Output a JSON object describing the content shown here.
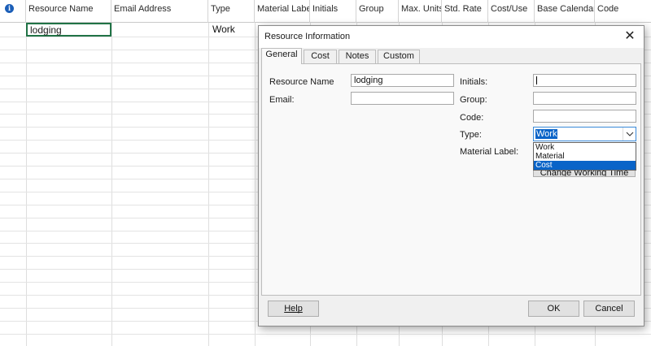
{
  "sheet": {
    "columns": [
      "Resource Name",
      "Email Address",
      "Type",
      "Material Label",
      "Initials",
      "Group",
      "Max. Units",
      "Std. Rate",
      "Cost/Use",
      "Base Calendar",
      "Code"
    ],
    "row1": {
      "resource_name": "lodging",
      "type": "Work"
    }
  },
  "dialog": {
    "title": "Resource Information",
    "tabs": [
      "General",
      "Cost",
      "Notes",
      "Custom"
    ],
    "labels": {
      "resource_name": "Resource Name",
      "email": "Email:",
      "initials": "Initials:",
      "group": "Group:",
      "code": "Code:",
      "type": "Type:",
      "material_label": "Material Label:"
    },
    "values": {
      "resource_name": "lodging",
      "email": "",
      "group": "",
      "code": "",
      "type": "Work"
    },
    "type_options": [
      "Work",
      "Material",
      "Cost"
    ],
    "type_highlighted": "Cost",
    "buttons": {
      "help": "Help",
      "change_working_time": "Change Working Time",
      "ok": "OK",
      "cancel": "Cancel"
    }
  },
  "colors": {
    "accent": "#0a64c8",
    "selected_cell_border": "#217346",
    "info_icon": "#1c5fb8"
  },
  "icons": [
    "info-icon",
    "close-icon",
    "chevron-down-icon"
  ]
}
